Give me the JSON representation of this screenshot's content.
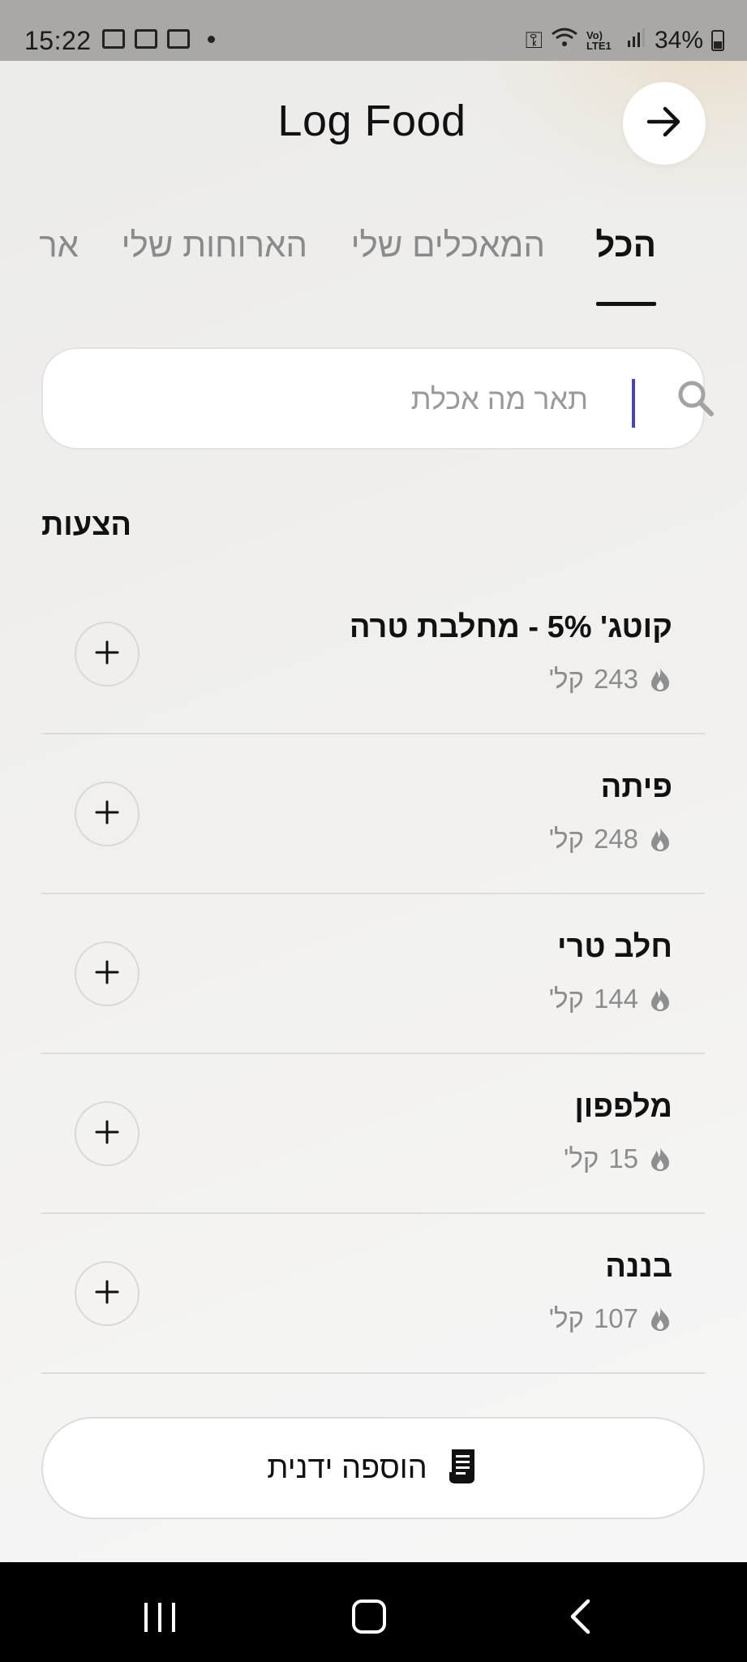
{
  "status_bar": {
    "time": "15:22",
    "network_label": "Vo) LTE1",
    "battery": "34%"
  },
  "header": {
    "title": "Log Food",
    "forward_icon": "arrow-right-icon"
  },
  "tabs": [
    {
      "label": "הכל",
      "active": true
    },
    {
      "label": "המאכלים שלי",
      "active": false
    },
    {
      "label": "הארוחות שלי",
      "active": false
    },
    {
      "label": "אר",
      "active": false
    }
  ],
  "search": {
    "placeholder": "תאר מה אכלת",
    "value": "",
    "icon": "search-icon"
  },
  "suggestions": {
    "title": "הצעות",
    "items": [
      {
        "name": "קוטג' 5% - מחלבת טרה",
        "calories": "243",
        "unit": "קל'"
      },
      {
        "name": "פיתה",
        "calories": "248",
        "unit": "קל'"
      },
      {
        "name": "חלב טרי",
        "calories": "144",
        "unit": "קל'"
      },
      {
        "name": "מלפפון",
        "calories": "15",
        "unit": "קל'"
      },
      {
        "name": "בננה",
        "calories": "107",
        "unit": "קל'"
      }
    ]
  },
  "manual_add": {
    "label": "הוספה ידנית",
    "icon": "receipt-icon"
  },
  "colors": {
    "accent": "#111111",
    "caret": "#4a47a8",
    "muted": "#8c8c8c"
  }
}
